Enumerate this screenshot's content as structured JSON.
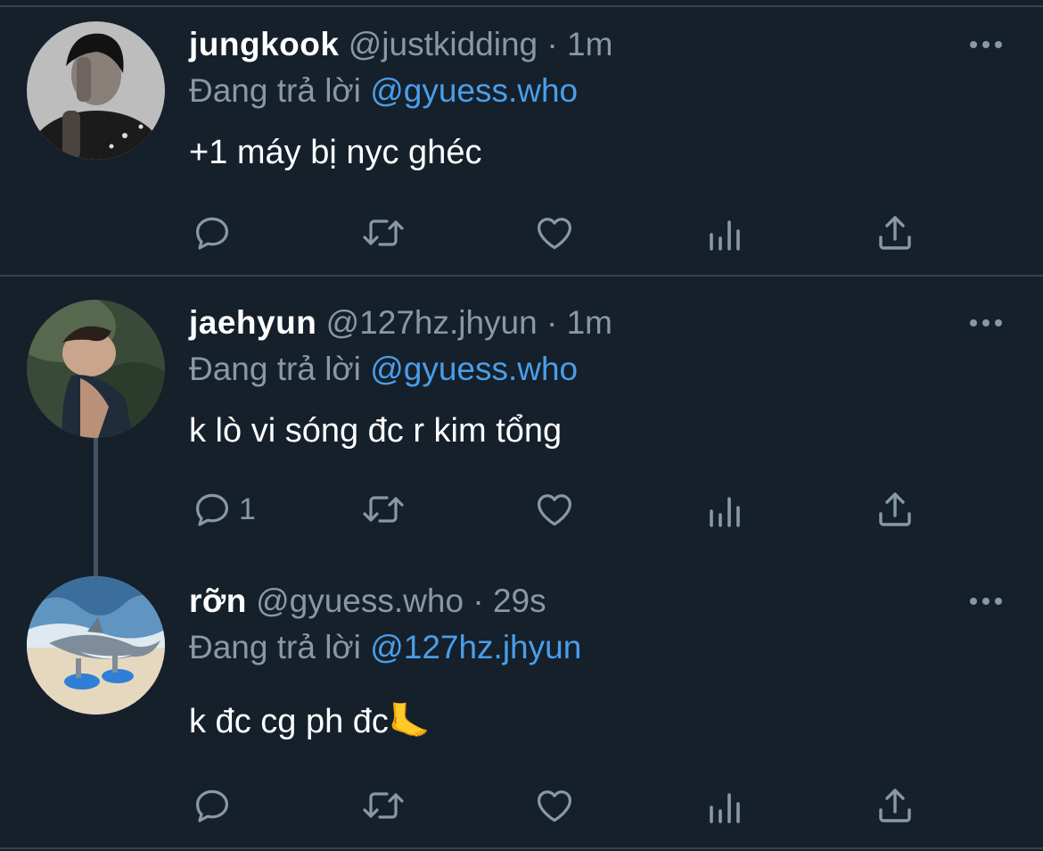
{
  "tweets": [
    {
      "name": "jungkook",
      "handle": "@justkidding",
      "separator": "·",
      "time": "1m",
      "replying_prefix": "Đang trả lời",
      "replying_to": "@gyuess.who",
      "text": "+1 máy bị nyc ghéc",
      "reply_count": "",
      "avatar": "profile-photo-dark-hair-hand-on-face"
    },
    {
      "name": "jaehyun",
      "handle": "@127hz.jhyun",
      "separator": "·",
      "time": "1m",
      "replying_prefix": "Đang trả lời",
      "replying_to": "@gyuess.who",
      "text": "k lò vi sóng đc r kim tổng",
      "reply_count": "1",
      "avatar": "profile-photo-man-lying-down"
    },
    {
      "name": "rỡn",
      "handle": "@gyuess.who",
      "separator": "·",
      "time": "29s",
      "replying_prefix": "Đang trả lời",
      "replying_to": "@127hz.jhyun",
      "text": "k đc cg ph đc🦶",
      "reply_count": "",
      "avatar": "shark-wearing-sneakers-on-beach"
    }
  ],
  "icons": {
    "reply": "reply-icon",
    "retweet": "retweet-icon",
    "like": "heart-icon",
    "analytics": "analytics-icon",
    "share": "share-icon",
    "more": "more-icon"
  },
  "colors": {
    "background": "#15202b",
    "divider": "#38444d",
    "secondary_text": "#8899a6",
    "link": "#4a9ee8",
    "primary_text": "#ffffff"
  }
}
